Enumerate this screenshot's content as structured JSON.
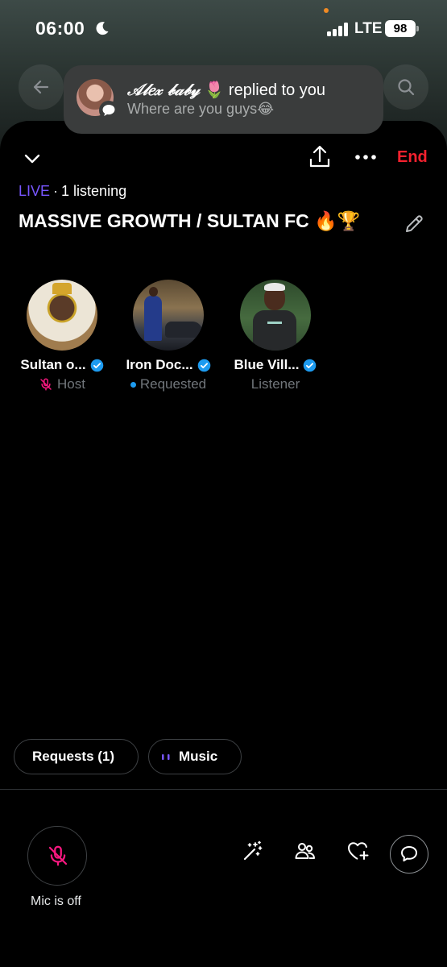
{
  "status_bar": {
    "time": "06:00",
    "network": "LTE",
    "battery": "98"
  },
  "notification": {
    "sender": "𝒜𝓁𝑒𝓍 𝒷𝒶𝒷𝓎",
    "emoji": "🌷",
    "action": "replied to you",
    "message": "Where are you guys😂"
  },
  "header": {
    "end_label": "End"
  },
  "space": {
    "live_label": "LIVE",
    "listening": "1 listening",
    "title": "MASSIVE GROWTH / SULTAN FC 🔥🏆"
  },
  "participants": [
    {
      "name": "Sultan o...",
      "role": "Host",
      "verified": true
    },
    {
      "name": "Iron Doc...",
      "role": "Requested",
      "verified": true
    },
    {
      "name": "Blue Vill...",
      "role": "Listener",
      "verified": true
    }
  ],
  "pills": {
    "requests": "Requests (1)",
    "music": "Music"
  },
  "footer": {
    "mic_label": "Mic is off"
  },
  "colors": {
    "live": "#7856ff",
    "end": "#f4212e",
    "verified": "#1d9bf0",
    "mic_off": "#f91880"
  }
}
